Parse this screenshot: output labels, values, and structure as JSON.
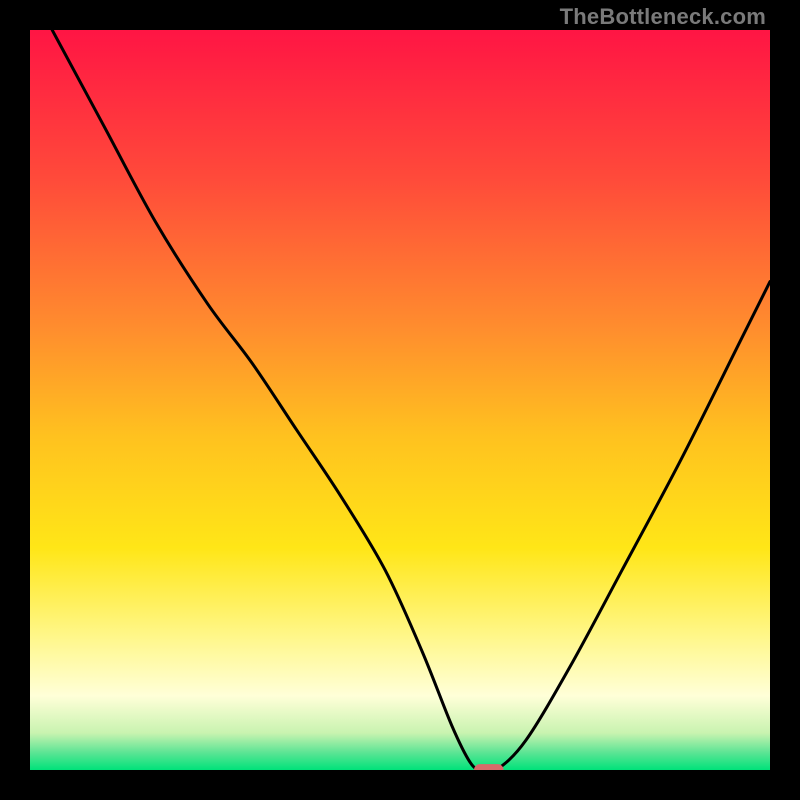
{
  "watermark": "TheBottleneck.com",
  "chart_data": {
    "type": "line",
    "title": "",
    "xlabel": "",
    "ylabel": "",
    "xlim": [
      0,
      100
    ],
    "ylim": [
      0,
      100
    ],
    "grid": false,
    "legend": false,
    "background_gradient_stops": [
      {
        "offset": 0.0,
        "color": "#ff1544"
      },
      {
        "offset": 0.2,
        "color": "#ff4a3a"
      },
      {
        "offset": 0.4,
        "color": "#ff8c2e"
      },
      {
        "offset": 0.55,
        "color": "#ffc21f"
      },
      {
        "offset": 0.7,
        "color": "#ffe617"
      },
      {
        "offset": 0.82,
        "color": "#fff78a"
      },
      {
        "offset": 0.9,
        "color": "#ffffd8"
      },
      {
        "offset": 0.95,
        "color": "#c9f3b0"
      },
      {
        "offset": 0.975,
        "color": "#62e596"
      },
      {
        "offset": 1.0,
        "color": "#00e27a"
      }
    ],
    "series": [
      {
        "name": "bottleneck-curve",
        "color": "#000000",
        "x": [
          3,
          10,
          17,
          24,
          30,
          36,
          42,
          48,
          53,
          57,
          59.5,
          61,
          63,
          67,
          73,
          80,
          88,
          96,
          100
        ],
        "y": [
          100,
          87,
          74,
          63,
          55,
          46,
          37,
          27,
          16,
          6,
          1,
          0,
          0,
          4,
          14,
          27,
          42,
          58,
          66
        ]
      }
    ],
    "marker": {
      "name": "optimal-point",
      "x": 62,
      "y": 0,
      "width_pct": 4.0,
      "height_pct": 1.6,
      "fill": "#d76a6a"
    }
  }
}
